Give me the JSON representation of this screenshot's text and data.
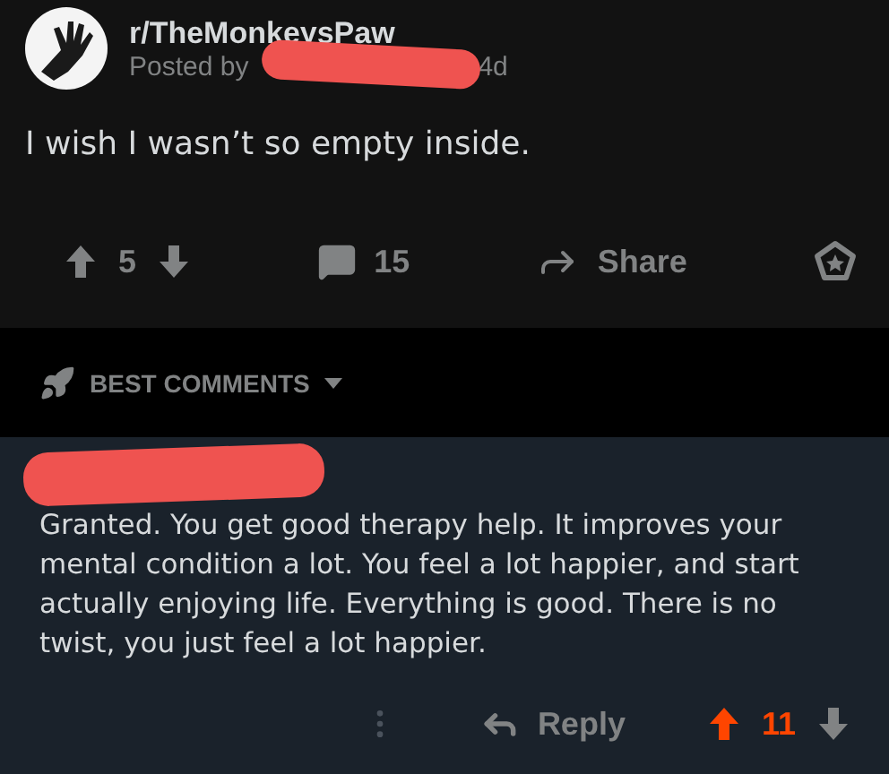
{
  "post": {
    "subreddit": "r/TheMonkeysPaw",
    "posted_by": "Posted by",
    "author_redacted": true,
    "age": "4d",
    "title": "I wish I wasn’t so empty inside.",
    "score": "5",
    "comments": "15",
    "share": "Share"
  },
  "sort": {
    "label": "BEST COMMENTS"
  },
  "comment": {
    "author_redacted": true,
    "text": "Granted. You get good therapy help. It improves your mental condition a lot. You feel a lot happier, and start actually enjoying life. Everything is good. There is no twist, you just feel a lot happier.",
    "reply": "Reply",
    "score": "11",
    "upvoted": true
  }
}
